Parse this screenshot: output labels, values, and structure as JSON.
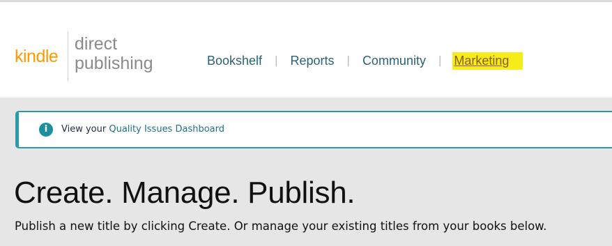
{
  "brand": {
    "kindle": "kindle",
    "direct": "direct",
    "publishing": "publishing",
    "colors": {
      "kindle": "#ff9900",
      "wordmark": "#8a8a8a"
    }
  },
  "nav": {
    "items": [
      {
        "label": "Bookshelf"
      },
      {
        "label": "Reports"
      },
      {
        "label": "Community"
      },
      {
        "label": "Marketing",
        "highlighted": true
      }
    ],
    "separator": "|",
    "highlight_color": "#f6ec1a"
  },
  "notice": {
    "icon": "info-icon",
    "prefix": "View your",
    "link": "Quality Issues Dashboard",
    "accent_color": "#2a9ca7"
  },
  "main": {
    "headline": "Create. Manage. Publish.",
    "subheadline": "Publish a new title by clicking Create. Or manage your existing titles from your books below."
  }
}
